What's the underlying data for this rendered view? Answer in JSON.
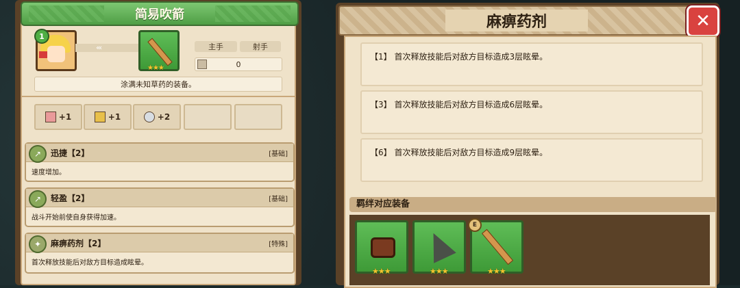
{
  "left_panel": {
    "title": "简易吹箭",
    "hero_level": "1",
    "tags": [
      "主手",
      "射手"
    ],
    "stat_value": "0",
    "description": "涂满未知草药的装备。",
    "stats": [
      {
        "icon": "pink-gem-icon",
        "value": "+1",
        "color": "#e99a9a"
      },
      {
        "icon": "gold-gem-icon",
        "value": "+1",
        "color": "#e8c04a"
      },
      {
        "icon": "silver-gem-icon",
        "value": "+2",
        "color": "#d8dde2"
      }
    ],
    "skills": [
      {
        "title": "迅捷【2】",
        "type": "[基础]",
        "desc": "速度增加。"
      },
      {
        "title": "轻盈【2】",
        "type": "[基础]",
        "desc": "战斗开始前使自身获得加速。"
      },
      {
        "title": "麻痹药剂【2】",
        "type": "[特殊]",
        "desc": "首次释放技能后对敌方目标造成眩晕。"
      }
    ]
  },
  "right_panel": {
    "title": "麻痹药剂",
    "levels": [
      "【1】 首次释放技能后对敌方目标造成3层眩晕。",
      "【3】 首次释放技能后对敌方目标造成6层眩晕。",
      "【6】 首次释放技能后对敌方目标造成9层眩晕。"
    ],
    "bond_title": "羁绊对应装备",
    "equipment": [
      {
        "icon": "bag-icon",
        "badge": ""
      },
      {
        "icon": "arrowhead-icon",
        "badge": ""
      },
      {
        "icon": "blowgun-icon",
        "badge": "E"
      }
    ],
    "stars": "★★★"
  }
}
